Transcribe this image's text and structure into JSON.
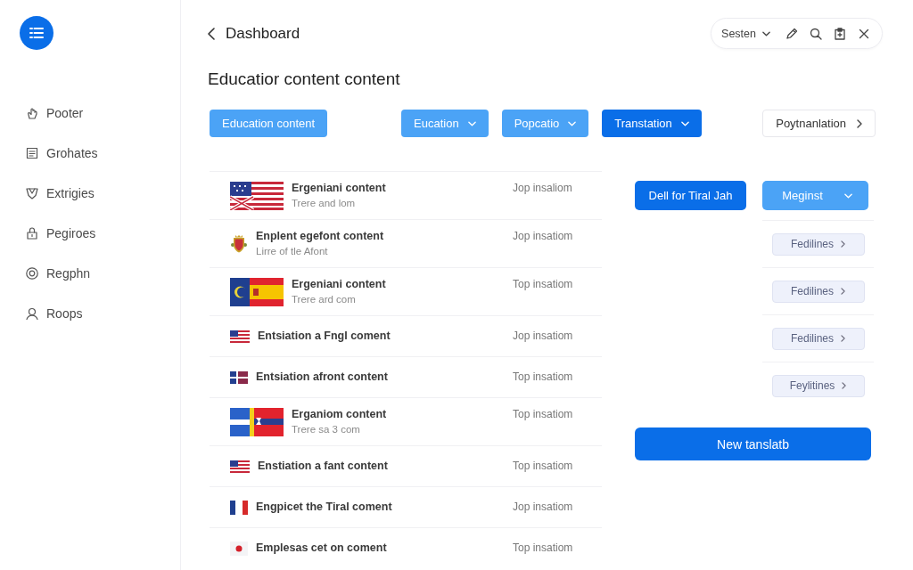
{
  "sidebar": {
    "items": [
      {
        "label": "Pooter"
      },
      {
        "label": "Grohates"
      },
      {
        "label": "Extrigies"
      },
      {
        "label": "Pegiroes"
      },
      {
        "label": "Regphn"
      },
      {
        "label": "Roops"
      }
    ]
  },
  "header": {
    "title": "Dashboard",
    "toolbar": {
      "dropdown": "Sesten"
    }
  },
  "page_title": "Educatior content content",
  "filters": [
    {
      "label": "Education content",
      "kind": "button",
      "selected": false
    },
    {
      "label": "Eucation",
      "kind": "dropdown",
      "selected": false
    },
    {
      "label": "Popcatio",
      "kind": "dropdown",
      "selected": false
    },
    {
      "label": "Transtation",
      "kind": "dropdown",
      "selected": true
    }
  ],
  "next_button": {
    "label": "Poytnanlation"
  },
  "rows": [
    {
      "title": "Ergeniani content",
      "subtitle": "Trere and lom",
      "status": "Jop insaliom"
    },
    {
      "title": "Enplent egefont content",
      "subtitle": "Lirre of tle Afont",
      "status": "Jop insatiom"
    },
    {
      "title": "Ergeniani content",
      "subtitle": "Trere ard com",
      "status": "Top insatiom"
    },
    {
      "title": "Entsiation a Fngl coment",
      "status": "Jop insatiom"
    },
    {
      "title": "Entsiation afront content",
      "status": "Top insatiom"
    },
    {
      "title": "Erganiom content",
      "subtitle": "Trere sa 3 com",
      "status": "Top insatiom"
    },
    {
      "title": "Enstiation a fant content",
      "status": "Top insatiom"
    },
    {
      "title": "Engpicet the Tiral coment",
      "status": "Jop insatiom"
    },
    {
      "title": "Emplesas cet on coment",
      "status": "Top insatiom"
    }
  ],
  "actions": {
    "buttons": [
      {
        "label": "Dell for Tiral Jah",
        "kind": "button",
        "primary": true
      },
      {
        "label": "Meginst",
        "kind": "dropdown",
        "primary": false
      }
    ],
    "items": [
      {
        "label": "Fedilines"
      },
      {
        "label": "Fedilines"
      },
      {
        "label": "Fedilines"
      },
      {
        "label": "Feylitines"
      }
    ],
    "new_button": "New tanslatb"
  }
}
